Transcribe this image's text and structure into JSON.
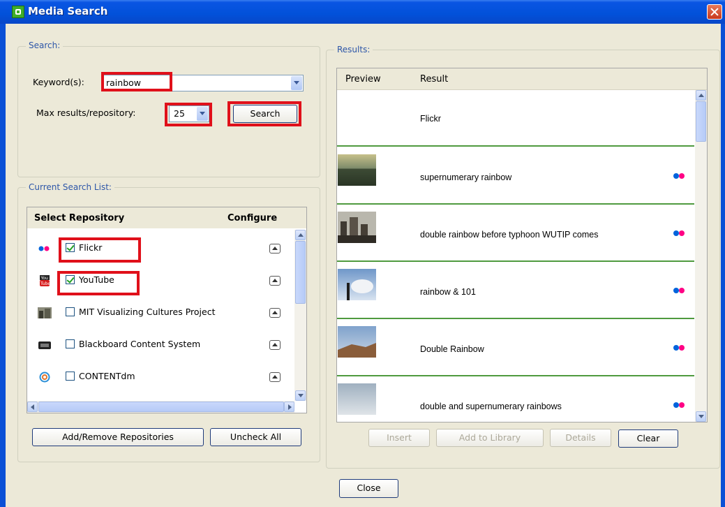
{
  "window": {
    "title": "Media Search"
  },
  "search": {
    "legend": "Search:",
    "keyword_label": "Keyword(s):",
    "keyword_value": "rainbow",
    "max_label": "Max results/repository:",
    "max_value": "25",
    "search_button": "Search"
  },
  "search_list": {
    "legend": "Current Search List:",
    "col_select": "Select Repository",
    "col_configure": "Configure",
    "repositories": [
      {
        "name": "Flickr",
        "checked": true,
        "icon": "flickr-icon"
      },
      {
        "name": "YouTube",
        "checked": true,
        "icon": "youtube-icon"
      },
      {
        "name": "MIT Visualizing Cultures Project",
        "checked": false,
        "icon": "mit-icon"
      },
      {
        "name": "Blackboard Content System",
        "checked": false,
        "icon": "blackboard-icon"
      },
      {
        "name": "CONTENTdm",
        "checked": false,
        "icon": "contentdm-icon"
      }
    ],
    "add_remove_button": "Add/Remove Repositories",
    "uncheck_all_button": "Uncheck All"
  },
  "results": {
    "legend": "Results:",
    "col_preview": "Preview",
    "col_result": "Result",
    "group_header": "Flickr",
    "rows": [
      {
        "text": "supernumerary rainbow"
      },
      {
        "text": "double rainbow before typhoon WUTIP comes"
      },
      {
        "text": "rainbow & 101"
      },
      {
        "text": "Double Rainbow"
      },
      {
        "text": "double and supernumerary rainbows"
      }
    ],
    "insert_button": "Insert",
    "add_library_button": "Add to Library",
    "details_button": "Details",
    "clear_button": "Clear"
  },
  "footer": {
    "close_button": "Close"
  },
  "colors": {
    "highlight": "#e0101a",
    "flickr_blue": "#0063dc",
    "flickr_pink": "#ff0084",
    "title_blue": "#0251d9"
  }
}
